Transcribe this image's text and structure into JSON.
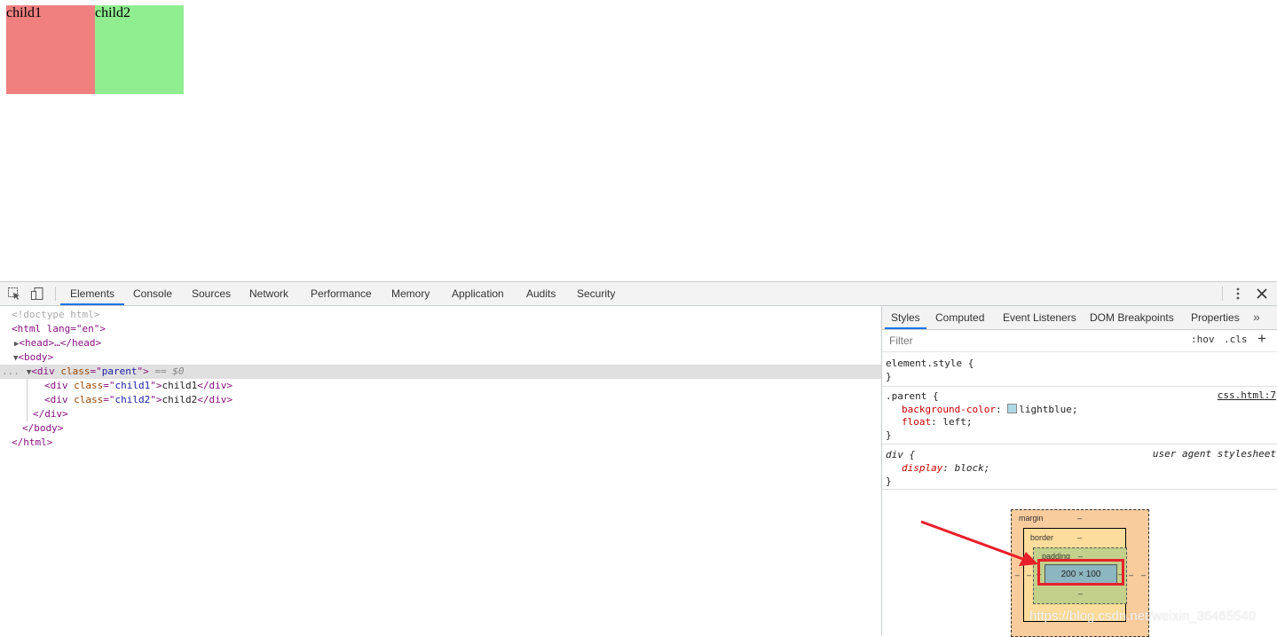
{
  "preview": {
    "child1_text": "child1",
    "child2_text": "child2",
    "child1_color": "#f08080",
    "child2_color": "#90ee90"
  },
  "toolbar": {
    "tabs": [
      {
        "label": "Elements",
        "active": true
      },
      {
        "label": "Console"
      },
      {
        "label": "Sources"
      },
      {
        "label": "Network"
      },
      {
        "label": "Performance"
      },
      {
        "label": "Memory"
      },
      {
        "label": "Application"
      },
      {
        "label": "Audits"
      },
      {
        "label": "Security"
      }
    ],
    "inspect_icon": "cursor-select-icon",
    "device_icon": "device-toggle-icon",
    "menu_icon": "kebab-menu-icon",
    "close_icon": "close-icon"
  },
  "dom": {
    "doctype": "<!doctype html>",
    "html_open": "<html lang=\"en\">",
    "head": "<head>…</head>",
    "body_open": "<body>",
    "parent_selected_suffix": "== $0",
    "parent_class": "parent",
    "child1_class": "child1",
    "child1_text": "child1",
    "child2_class": "child2",
    "child2_text": "child2",
    "div_close": "</div>",
    "body_close": "</body>",
    "html_close": "</html>",
    "ellipsis": "..."
  },
  "styles": {
    "tabs": [
      {
        "label": "Styles",
        "active": true
      },
      {
        "label": "Computed"
      },
      {
        "label": "Event Listeners"
      },
      {
        "label": "DOM Breakpoints"
      },
      {
        "label": "Properties"
      }
    ],
    "more_icon": "chevron-double-right-icon",
    "filter_placeholder": "Filter",
    "hov": ":hov",
    "cls": ".cls",
    "add_icon": "plus-icon",
    "element_style": "element.style {",
    "close_brace": "}",
    "parent_rule": {
      "selector": ".parent {",
      "source": "css.html:7",
      "prop1": "background-color",
      "val1": "lightblue",
      "prop2": "float",
      "val2": "left"
    },
    "div_rule": {
      "selector": "div {",
      "source": "user agent stylesheet",
      "prop1": "display",
      "val1": "block"
    }
  },
  "box_model": {
    "margin_label": "margin",
    "border_label": "border",
    "padding_label": "padding",
    "dash": "–",
    "content": "200 × 100",
    "highlight_color": "#e8202a"
  },
  "watermark": "https://blog.csdn.net/weixin_36465540"
}
